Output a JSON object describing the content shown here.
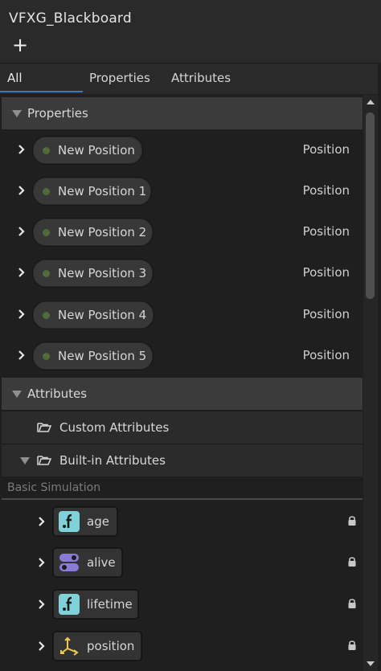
{
  "window": {
    "title": "VFXG_Blackboard",
    "add_label": "+"
  },
  "tabs": [
    {
      "label": "All",
      "active": true
    },
    {
      "label": "Properties",
      "active": false
    },
    {
      "label": "Attributes",
      "active": false
    }
  ],
  "properties_section": {
    "label": "Properties",
    "items": [
      {
        "name": "New Position",
        "type": "Position"
      },
      {
        "name": "New Position 1",
        "type": "Position"
      },
      {
        "name": "New Position 2",
        "type": "Position"
      },
      {
        "name": "New Position 3",
        "type": "Position"
      },
      {
        "name": "New Position 4",
        "type": "Position"
      },
      {
        "name": "New Position 5",
        "type": "Position"
      }
    ]
  },
  "attributes_section": {
    "label": "Attributes",
    "custom_folder": "Custom Attributes",
    "builtin_folder": "Built-in Attributes",
    "category": "Basic Simulation",
    "items": [
      {
        "name": "age",
        "icon": "float-icon",
        "locked": true
      },
      {
        "name": "alive",
        "icon": "bool-icon",
        "locked": true
      },
      {
        "name": "lifetime",
        "icon": "float-icon",
        "locked": true
      },
      {
        "name": "position",
        "icon": "vector3-icon",
        "locked": true
      }
    ]
  },
  "colors": {
    "accent": "#3a79bb",
    "property_dot": "#4e6b3a",
    "float_icon": "#7fd3d8",
    "bool_icon": "#8c7ad9",
    "vector_icon": "#f0c850"
  }
}
